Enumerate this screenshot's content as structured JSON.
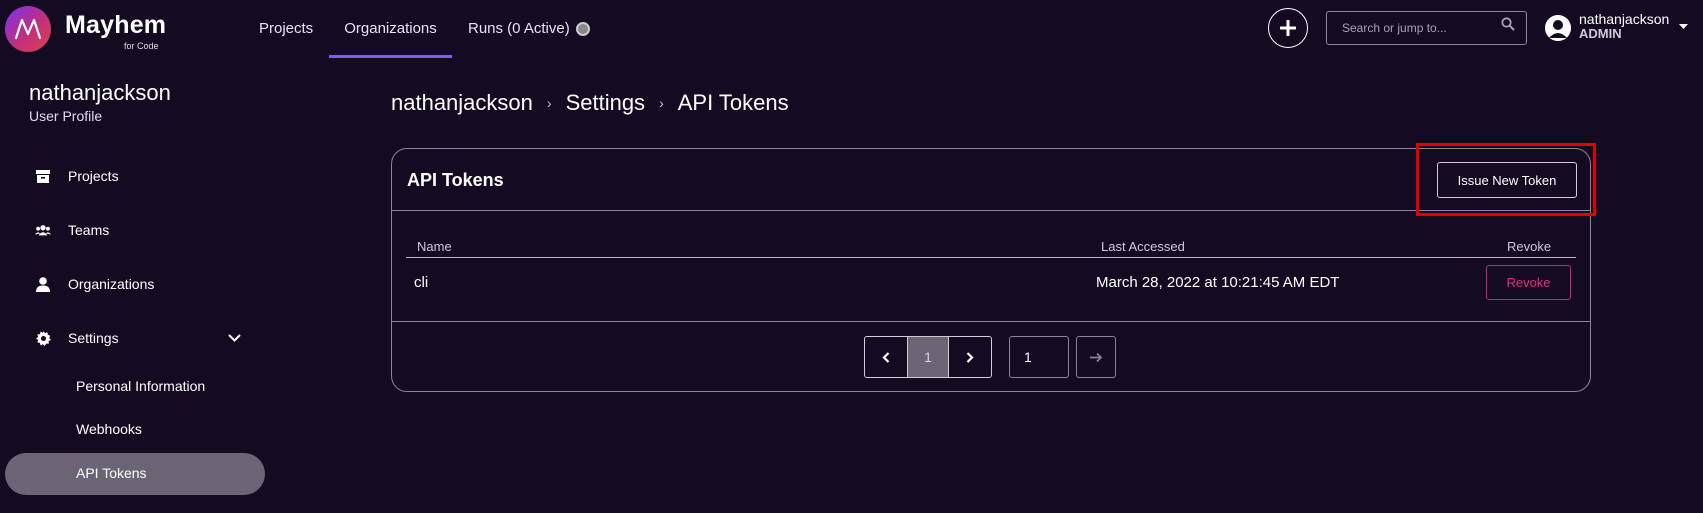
{
  "header": {
    "logo_name": "Mayhem",
    "logo_sub": "for Code",
    "nav": {
      "projects": "Projects",
      "organizations": "Organizations",
      "runs": "Runs (0 Active)"
    },
    "search_placeholder": "Search or jump to...",
    "user": {
      "name": "nathanjackson",
      "role": "ADMIN"
    }
  },
  "sidebar": {
    "user": "nathanjackson",
    "subtitle": "User Profile",
    "items": [
      {
        "label": "Projects",
        "icon": "archive-icon"
      },
      {
        "label": "Teams",
        "icon": "users-icon"
      },
      {
        "label": "Organizations",
        "icon": "user-icon"
      },
      {
        "label": "Settings",
        "icon": "gear-icon"
      }
    ],
    "settings_children": [
      {
        "label": "Personal Information"
      },
      {
        "label": "Webhooks"
      },
      {
        "label": "API Tokens",
        "active": true
      }
    ]
  },
  "breadcrumb": [
    "nathanjackson",
    "Settings",
    "API Tokens"
  ],
  "card": {
    "title": "API Tokens",
    "issue_button": "Issue New Token",
    "columns": {
      "name": "Name",
      "last_accessed": "Last Accessed",
      "revoke": "Revoke"
    },
    "rows": [
      {
        "name": "cli",
        "last_accessed": "March 28, 2022 at 10:21:45 AM EDT",
        "revoke_label": "Revoke"
      }
    ],
    "pagination": {
      "current_page": "1",
      "page_input": "1"
    }
  },
  "colors": {
    "background": "#140a22",
    "accent": "#7b5cff",
    "danger": "#d0206a",
    "highlight": "#e00000"
  }
}
